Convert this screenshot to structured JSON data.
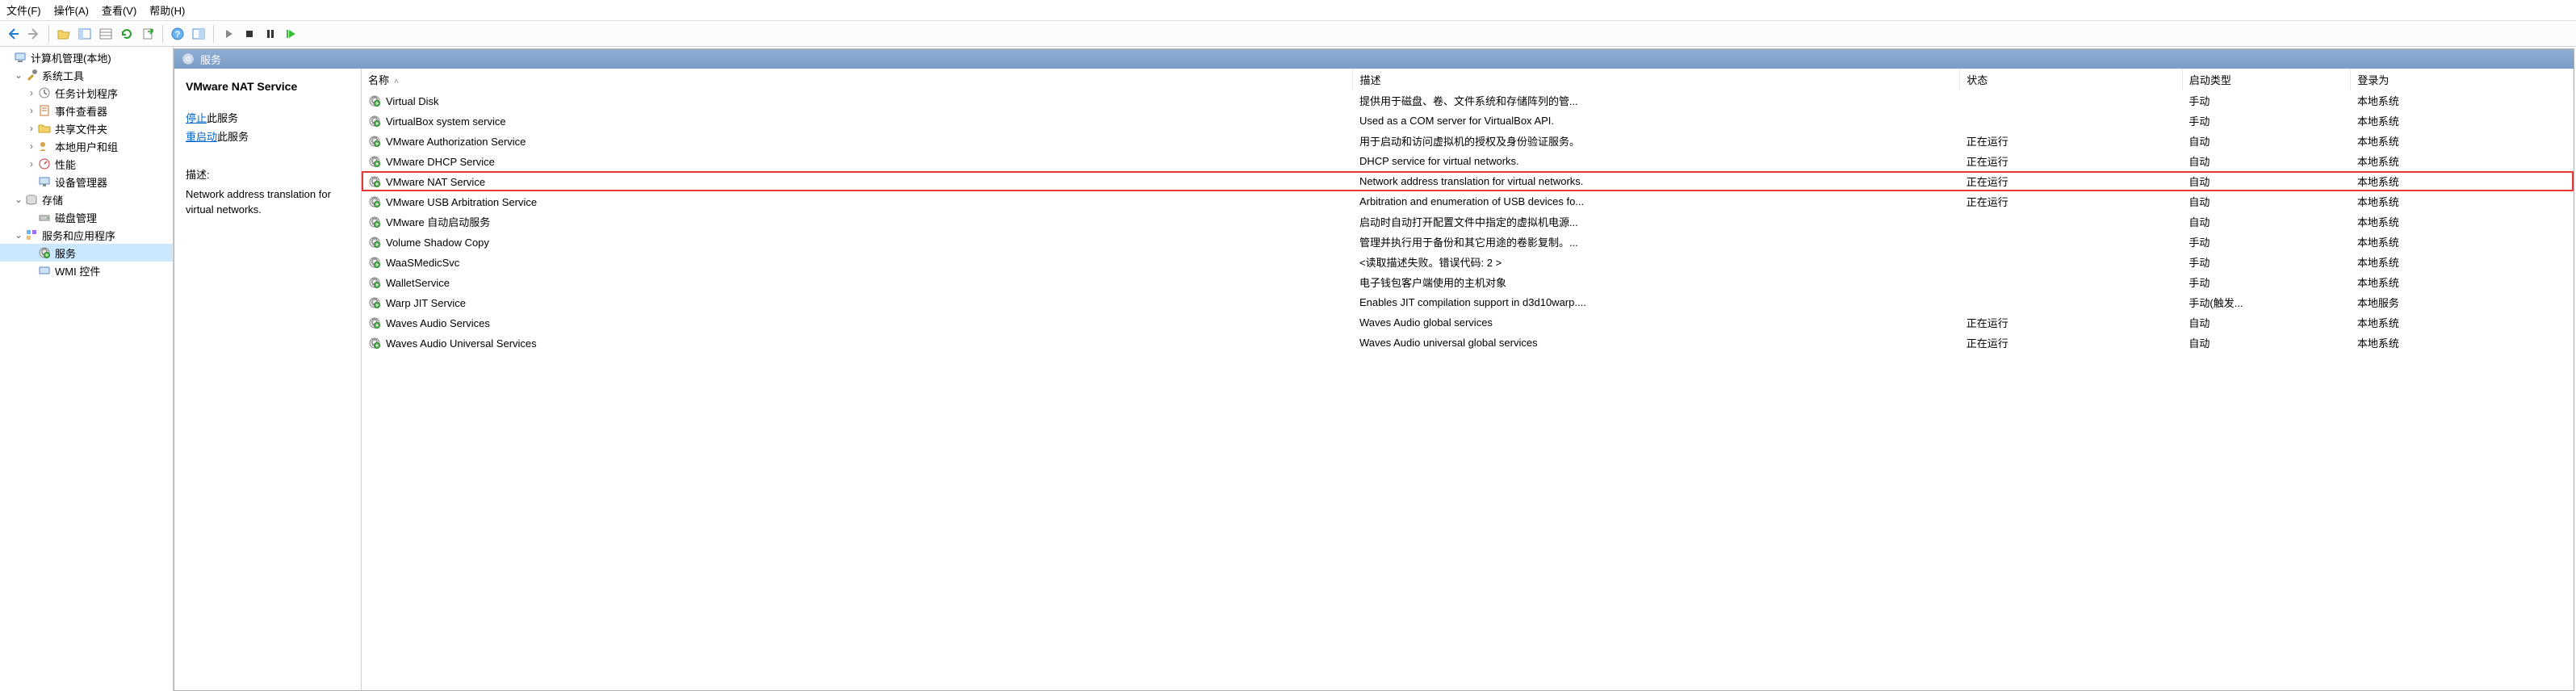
{
  "menu": {
    "file": "文件(F)",
    "action": "操作(A)",
    "view": "查看(V)",
    "help": "帮助(H)"
  },
  "tree": {
    "root": "计算机管理(本地)",
    "system_tools": "系统工具",
    "task_scheduler": "任务计划程序",
    "event_viewer": "事件查看器",
    "shared_folders": "共享文件夹",
    "local_users": "本地用户和组",
    "performance": "性能",
    "device_manager": "设备管理器",
    "storage": "存储",
    "disk_mgmt": "磁盘管理",
    "services_apps": "服务和应用程序",
    "services": "服务",
    "wmi": "WMI 控件"
  },
  "panel": {
    "title": "服务",
    "selected_service": "VMware NAT Service",
    "stop_link": "停止",
    "restart_link": "重启动",
    "this_service": "此服务",
    "desc_label": "描述:",
    "desc_text": "Network address translation for virtual networks."
  },
  "columns": {
    "name": "名称",
    "desc": "描述",
    "state": "状态",
    "startup": "启动类型",
    "logon": "登录为"
  },
  "services": [
    {
      "name": "Virtual Disk",
      "desc": "提供用于磁盘、卷、文件系统和存储阵列的管...",
      "state": "",
      "startup": "手动",
      "logon": "本地系统"
    },
    {
      "name": "VirtualBox system service",
      "desc": "Used as a COM server for VirtualBox API.",
      "state": "",
      "startup": "手动",
      "logon": "本地系统"
    },
    {
      "name": "VMware Authorization Service",
      "desc": "用于启动和访问虚拟机的授权及身份验证服务。",
      "state": "正在运行",
      "startup": "自动",
      "logon": "本地系统"
    },
    {
      "name": "VMware DHCP Service",
      "desc": "DHCP service for virtual networks.",
      "state": "正在运行",
      "startup": "自动",
      "logon": "本地系统"
    },
    {
      "name": "VMware NAT Service",
      "desc": "Network address translation for virtual networks.",
      "state": "正在运行",
      "startup": "自动",
      "logon": "本地系统",
      "highlight": true
    },
    {
      "name": "VMware USB Arbitration Service",
      "desc": "Arbitration and enumeration of USB devices fo...",
      "state": "正在运行",
      "startup": "自动",
      "logon": "本地系统"
    },
    {
      "name": "VMware 自动启动服务",
      "desc": "启动时自动打开配置文件中指定的虚拟机电源...",
      "state": "",
      "startup": "自动",
      "logon": "本地系统"
    },
    {
      "name": "Volume Shadow Copy",
      "desc": "管理并执行用于备份和其它用途的卷影复制。...",
      "state": "",
      "startup": "手动",
      "logon": "本地系统"
    },
    {
      "name": "WaaSMedicSvc",
      "desc": "<读取描述失败。错误代码: 2 >",
      "state": "",
      "startup": "手动",
      "logon": "本地系统"
    },
    {
      "name": "WalletService",
      "desc": "电子钱包客户端使用的主机对象",
      "state": "",
      "startup": "手动",
      "logon": "本地系统"
    },
    {
      "name": "Warp JIT Service",
      "desc": "Enables JIT compilation support in d3d10warp....",
      "state": "",
      "startup": "手动(触发...",
      "logon": "本地服务"
    },
    {
      "name": "Waves Audio Services",
      "desc": "Waves Audio global services",
      "state": "正在运行",
      "startup": "自动",
      "logon": "本地系统"
    },
    {
      "name": "Waves Audio Universal Services",
      "desc": "Waves Audio universal global services",
      "state": "正在运行",
      "startup": "自动",
      "logon": "本地系统"
    }
  ]
}
